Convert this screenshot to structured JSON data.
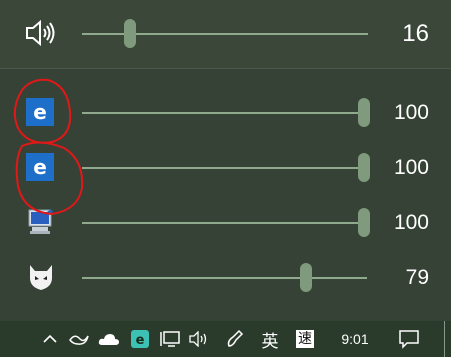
{
  "master": {
    "icon": "speaker-icon",
    "volume": 16,
    "label": "16"
  },
  "apps": [
    {
      "icon": "edge-icon",
      "volume": 100,
      "label": "100"
    },
    {
      "icon": "edge-icon",
      "volume": 100,
      "label": "100"
    },
    {
      "icon": "system-sounds-icon",
      "volume": 100,
      "label": "100"
    },
    {
      "icon": "foobar-icon",
      "volume": 79,
      "label": "79"
    }
  ],
  "taskbar": {
    "chevron_icon": "chevron-up-icon",
    "items": [
      "bird-icon",
      "onedrive-icon",
      "edge-tray-icon",
      "network-icon",
      "volume-tray-icon",
      "pen-icon"
    ],
    "ime": "英",
    "ime2": "速",
    "time": "9:01",
    "notification_icon": "action-center-icon"
  },
  "colors": {
    "accent": "#8fa98c",
    "thumb": "#7f9a7c",
    "edge_blue": "#1e6fc9",
    "annotation": "#e01818"
  }
}
